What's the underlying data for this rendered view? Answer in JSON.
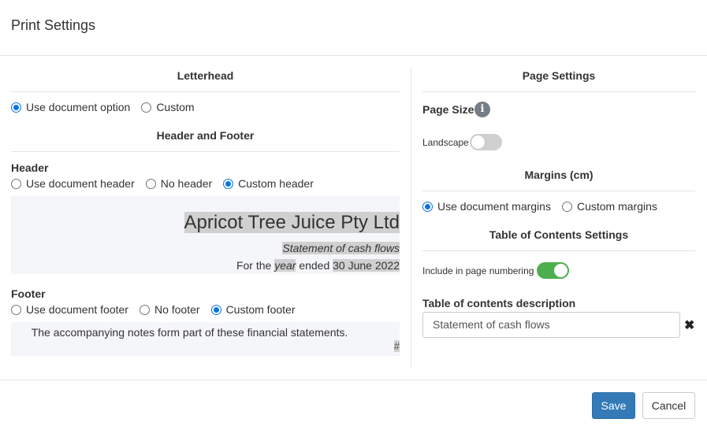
{
  "dialog": {
    "title": "Print Settings"
  },
  "letterhead": {
    "title": "Letterhead",
    "options": [
      "Use document option",
      "Custom"
    ],
    "selected": 0
  },
  "header_footer": {
    "title": "Header and Footer",
    "header_label": "Header",
    "header_options": [
      "Use document header",
      "No header",
      "Custom header"
    ],
    "header_selected": 2,
    "header_preview": {
      "company": "Apricot Tree Juice Pty Ltd",
      "statement": "Statement of cash flows",
      "period_prefix": "For the",
      "period_word": "year",
      "period_mid": "ended",
      "period_date": "30 June 2022"
    },
    "footer_label": "Footer",
    "footer_options": [
      "Use document footer",
      "No footer",
      "Custom footer"
    ],
    "footer_selected": 2,
    "footer_preview": {
      "text": "The accompanying notes form part of these financial statements.",
      "page_marker": "#"
    }
  },
  "page_settings": {
    "title": "Page Settings",
    "page_size_label": "Page Size",
    "info_icon": "info-icon",
    "landscape_label": "Landscape",
    "landscape_on": false,
    "margins_title": "Margins (cm)",
    "margin_options": [
      "Use document margins",
      "Custom margins"
    ],
    "margin_selected": 0
  },
  "toc": {
    "title": "Table of Contents Settings",
    "include_label": "Include in page numbering",
    "include_on": true,
    "description_label": "Table of contents description",
    "description_value": "Statement of cash flows",
    "clear_icon": "close-icon"
  },
  "actions": {
    "save": "Save",
    "cancel": "Cancel"
  },
  "colors": {
    "primary": "#337ab7",
    "toggle_on": "#4cae4c",
    "radio": "#0b75e0"
  }
}
